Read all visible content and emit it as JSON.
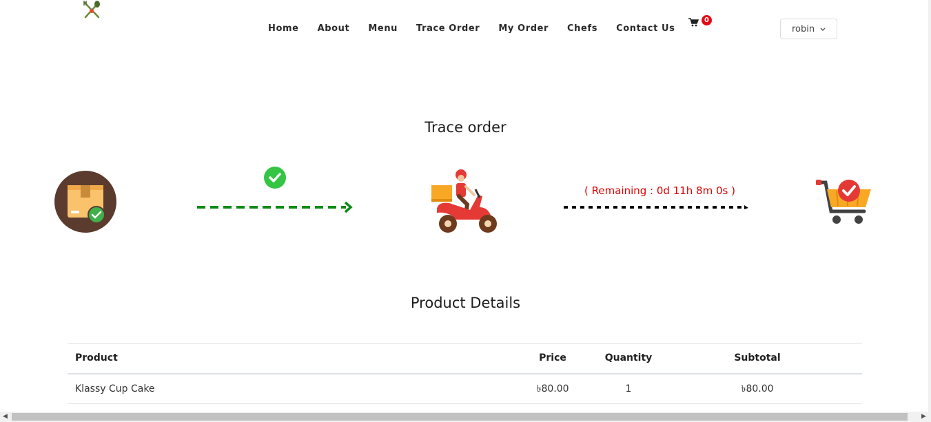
{
  "nav": {
    "items": [
      "Home",
      "About",
      "Menu",
      "Trace Order",
      "My Order",
      "Chefs",
      "Contact Us"
    ]
  },
  "cart": {
    "icon": "shopping-cart-icon",
    "count": "0"
  },
  "user": {
    "name": "robin",
    "icon": "chevron-down-icon"
  },
  "trace": {
    "heading": "Trace order",
    "remaining": "( Remaining : 0d 11h 8m 0s )"
  },
  "details": {
    "heading": "Product Details",
    "columns": [
      "Product",
      "Price",
      "Quantity",
      "Subtotal"
    ],
    "rows": [
      {
        "product": "Klassy Cup Cake",
        "price": "৳80.00",
        "quantity": "1",
        "subtotal": "৳80.00"
      }
    ]
  },
  "colors": {
    "accent_green": "#0c8a14",
    "check_green": "#34c545",
    "badge_red": "#e50914",
    "remaining_red": "#e10000"
  }
}
